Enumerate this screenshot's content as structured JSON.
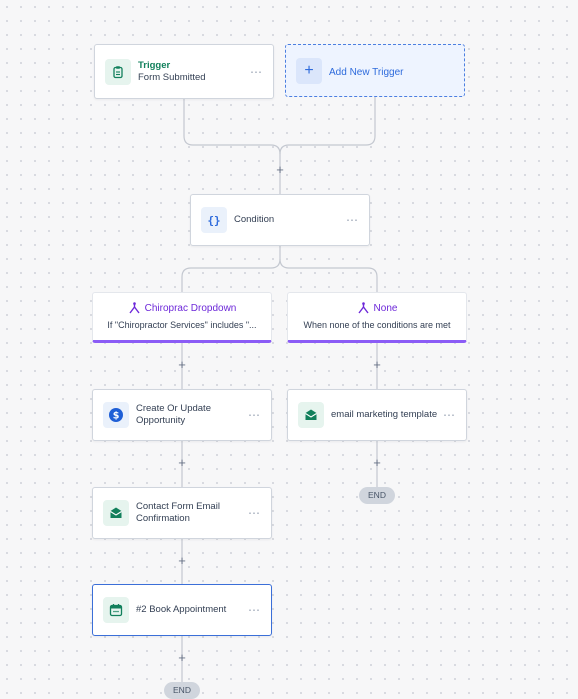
{
  "trigger": {
    "title": "Trigger",
    "subtitle": "Form Submitted",
    "icon": "clipboard-icon"
  },
  "add_trigger": {
    "label": "Add New Trigger",
    "icon": "plus-icon"
  },
  "condition": {
    "label": "Condition",
    "icon": "braces-icon"
  },
  "branches": [
    {
      "title": "Chiroprac Dropdown",
      "subtitle": "If \"Chiropractor Services\" includes \"...",
      "icon": "branch-icon"
    },
    {
      "title": "None",
      "subtitle": "When none of the conditions are met",
      "icon": "branch-icon"
    }
  ],
  "actions": {
    "create_opportunity": {
      "label_line1": "Create Or Update",
      "label_line2": "Opportunity",
      "icon": "dollar-icon"
    },
    "email_marketing": {
      "label": "email marketing template",
      "icon": "email-icon"
    },
    "contact_form_email": {
      "label_line1": "Contact Form Email",
      "label_line2": "Confirmation",
      "icon": "email-icon"
    },
    "book_appointment": {
      "label": "#2 Book Appointment",
      "icon": "calendar-icon"
    }
  },
  "menu_glyph": "⋯",
  "plus_glyph": "+",
  "end_label": "END",
  "colors": {
    "accent_blue": "#2e6bdc",
    "branch_purple": "#8b5cf6",
    "trigger_green": "#12805c",
    "wire": "#c4c8d0"
  }
}
